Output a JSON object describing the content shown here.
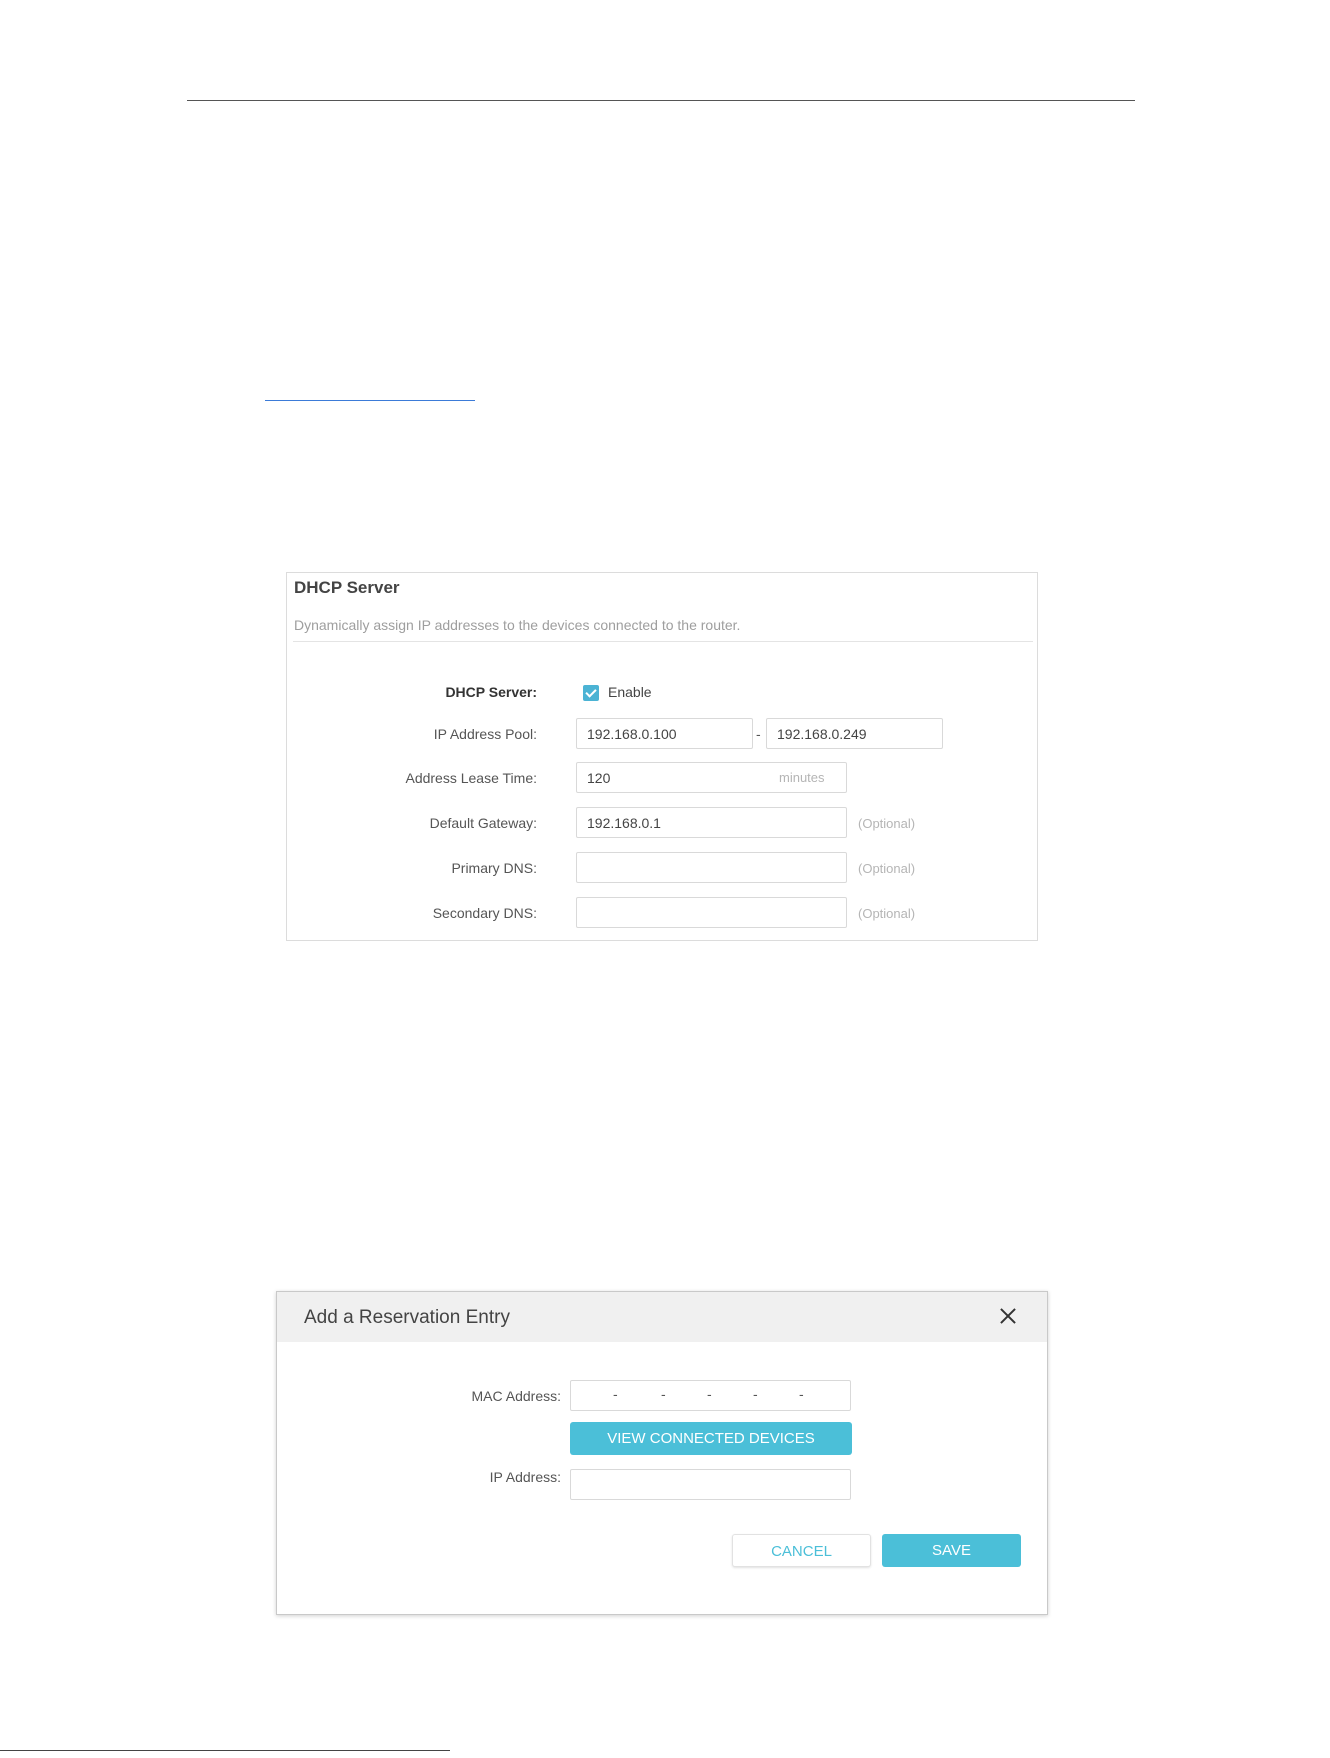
{
  "dhcp": {
    "title": "DHCP Server",
    "description": "Dynamically assign IP addresses to the devices connected to the router.",
    "server_label": "DHCP Server:",
    "enable_label": "Enable",
    "enabled": true,
    "pool_label": "IP Address Pool:",
    "pool_start": "192.168.0.100",
    "pool_separator": "-",
    "pool_end": "192.168.0.249",
    "lease_label": "Address Lease Time:",
    "lease_value": "120",
    "lease_unit": "minutes",
    "gateway_label": "Default Gateway:",
    "gateway_value": "192.168.0.1",
    "gateway_hint": "(Optional)",
    "primary_dns_label": "Primary DNS:",
    "primary_dns_value": "",
    "primary_dns_hint": "(Optional)",
    "secondary_dns_label": "Secondary DNS:",
    "secondary_dns_value": "",
    "secondary_dns_hint": "(Optional)"
  },
  "reservation_modal": {
    "title": "Add a Reservation Entry",
    "mac_label": "MAC Address:",
    "mac_separators": [
      "-",
      "-",
      "-",
      "-",
      "-"
    ],
    "view_devices_label": "VIEW CONNECTED DEVICES",
    "ip_label": "IP Address:",
    "ip_value": "",
    "cancel_label": "CANCEL",
    "save_label": "SAVE"
  },
  "icons": {
    "close": "close-icon",
    "checkbox": "checkbox-checked-icon"
  },
  "colors": {
    "accent": "#4bbfd8",
    "checkbox": "#4bb3d4"
  }
}
